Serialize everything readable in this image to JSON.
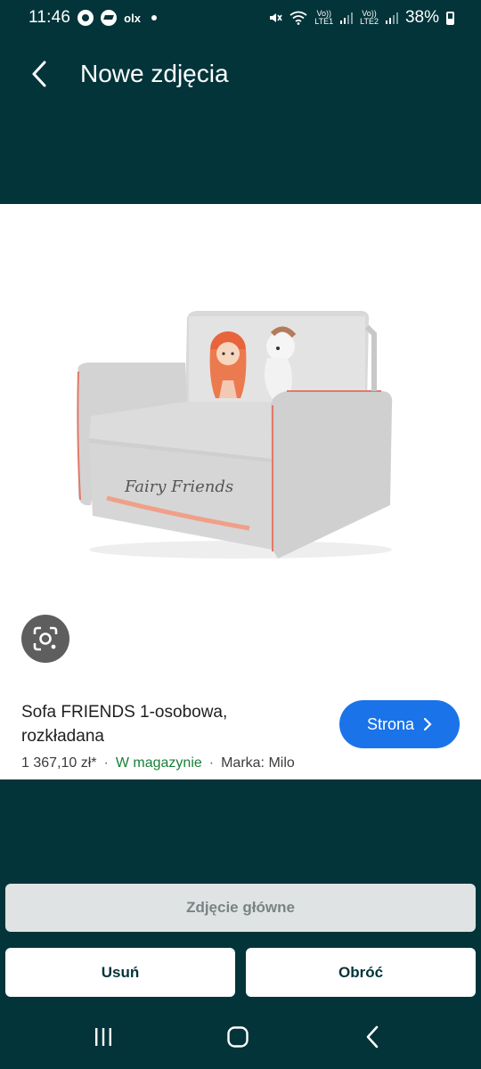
{
  "status_bar": {
    "time": "11:46",
    "notifications": [
      "whatsapp-icon",
      "messenger-icon",
      "olx-icon",
      "dot-icon"
    ],
    "olx_label": "olx",
    "sim1_label_top": "Vo))",
    "sim1_label_bottom": "LTE1",
    "sim2_label_top": "Vo))",
    "sim2_label_bottom": "LTE2",
    "battery_percent": "38%"
  },
  "header": {
    "title": "Nowe zdjęcia",
    "back_icon": "chevron-left-icon"
  },
  "product": {
    "title": "Sofa FRIENDS 1-osobowa, rozkładana",
    "price": "1 367,10 zł*",
    "separator": "·",
    "stock": "W magazynie",
    "brand": "Marka: Milo",
    "image_text": "Fairy Friends",
    "link_button_label": "Strona"
  },
  "actions": {
    "main_photo_label": "Zdjęcie główne",
    "delete_label": "Usuń",
    "rotate_label": "Obróć"
  },
  "nav_bar": {
    "icons": [
      "recents-icon",
      "home-icon",
      "back-icon"
    ]
  },
  "colors": {
    "background": "#02343a",
    "card": "#ffffff",
    "accent_blue": "#1a73e8",
    "stock_green": "#188038",
    "disabled_button": "#dfe3e3"
  }
}
